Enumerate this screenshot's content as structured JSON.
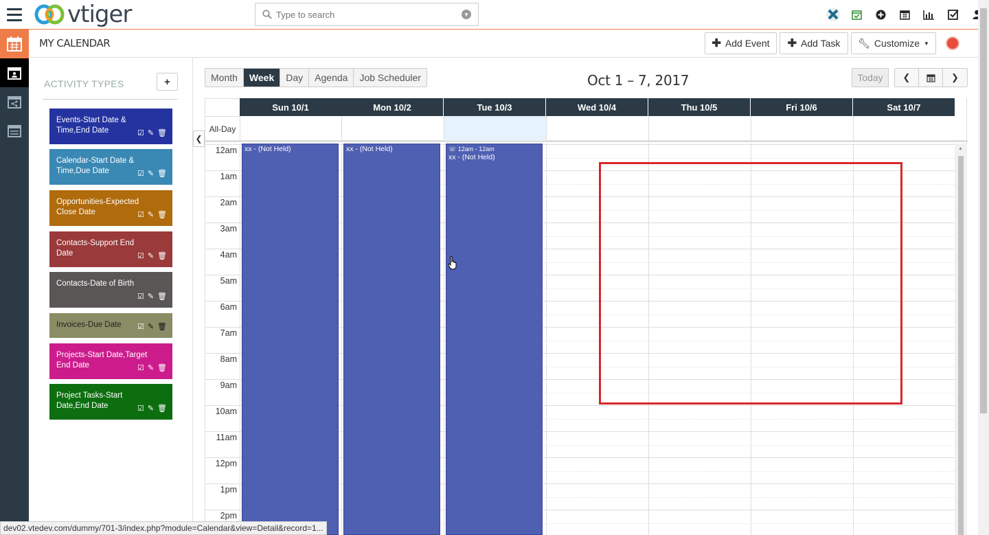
{
  "app": {
    "logo_text": "vtiger"
  },
  "search": {
    "placeholder": "Type to search"
  },
  "top_icons": [
    "vtiger-x-icon",
    "calendar-check-icon",
    "plus-circle-icon",
    "calendar-icon",
    "bar-chart-icon",
    "checkbox-icon",
    "user-icon"
  ],
  "module": {
    "title": "MY CALENDAR"
  },
  "header_buttons": {
    "add_event": "Add Event",
    "add_task": "Add Task",
    "customize": "Customize"
  },
  "activity_types": {
    "title": "ACTIVITY TYPES",
    "add_label": "+",
    "items": [
      {
        "label": "Events-Start Date & Time,End Date",
        "color": "#2433a0"
      },
      {
        "label": "Calendar-Start Date & Time,Due Date",
        "color": "#3a89b4"
      },
      {
        "label": "Opportunities-Expected Close Date",
        "color": "#b06b0c"
      },
      {
        "label": "Contacts-Support End Date",
        "color": "#9a3a3a"
      },
      {
        "label": "Contacts-Date of Birth",
        "color": "#5a5656"
      },
      {
        "label": "Invoices-Due Date",
        "color": "#8a8c65"
      },
      {
        "label": "Projects-Start Date,Target End Date",
        "color": "#cc1c8c"
      },
      {
        "label": "Project Tasks-Start Date,End Date",
        "color": "#0d6e10"
      }
    ]
  },
  "views": [
    "Month",
    "Week",
    "Day",
    "Agenda",
    "Job Scheduler"
  ],
  "active_view": "Week",
  "date_range": "Oct 1 – 7, 2017",
  "today_label": "Today",
  "days": [
    "Sun 10/1",
    "Mon 10/2",
    "Tue 10/3",
    "Wed 10/4",
    "Thu 10/5",
    "Fri 10/6",
    "Sat 10/7"
  ],
  "allday_label": "All-Day",
  "hours": [
    "12am",
    "1am",
    "2am",
    "3am",
    "4am",
    "5am",
    "6am",
    "7am",
    "8am",
    "9am",
    "10am",
    "11am",
    "12pm",
    "1pm",
    "2pm"
  ],
  "events": [
    {
      "day": "Sun 10/1",
      "time": "",
      "title": "xx - (Not Held)"
    },
    {
      "day": "Mon 10/2",
      "time": "",
      "title": "xx - (Not Held)"
    },
    {
      "day": "Tue 10/3",
      "time": "12am - 12am",
      "title": "xx - (Not Held)"
    }
  ],
  "status_url": "dev02.vtedev.com/dummy/701-3/index.php?module=Calendar&view=Detail&record=1..."
}
